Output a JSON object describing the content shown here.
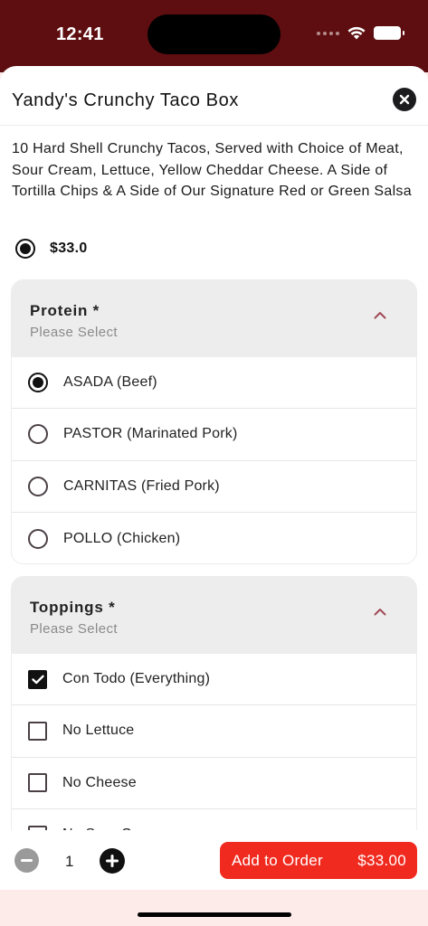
{
  "status_bar": {
    "time": "12:41"
  },
  "item": {
    "title": "Yandy's Crunchy Taco Box",
    "description": "10 Hard Shell Crunchy Tacos, Served with Choice of Meat, Sour Cream, Lettuce, Yellow Cheddar Cheese. A Side of Tortilla Chips & A Side of Our Signature Red or Green Salsa",
    "price": "$33.0"
  },
  "protein": {
    "title": "Protein *",
    "subtitle": "Please Select",
    "options": [
      {
        "label": "ASADA (Beef)",
        "selected": true
      },
      {
        "label": "PASTOR (Marinated Pork)",
        "selected": false
      },
      {
        "label": "CARNITAS (Fried Pork)",
        "selected": false
      },
      {
        "label": "POLLO (Chicken)",
        "selected": false
      }
    ]
  },
  "toppings": {
    "title": "Toppings *",
    "subtitle": "Please Select",
    "options": [
      {
        "label": "Con Todo (Everything)",
        "checked": true
      },
      {
        "label": "No Lettuce",
        "checked": false
      },
      {
        "label": "No Cheese",
        "checked": false
      },
      {
        "label": "No Sour Cream",
        "checked": false
      }
    ]
  },
  "bottom_bar": {
    "quantity": "1",
    "add_label": "Add to Order",
    "total": "$33.00"
  },
  "colors": {
    "status_bar": "#5e0e10",
    "accent": "#f02a1f",
    "chevron": "#a04a56"
  },
  "icons": {
    "close": "close-icon",
    "chevron": "chevron-up-icon",
    "minus": "minus-icon",
    "plus": "plus-icon",
    "check": "checkmark-icon",
    "wifi": "wifi-icon",
    "battery": "battery-icon"
  }
}
